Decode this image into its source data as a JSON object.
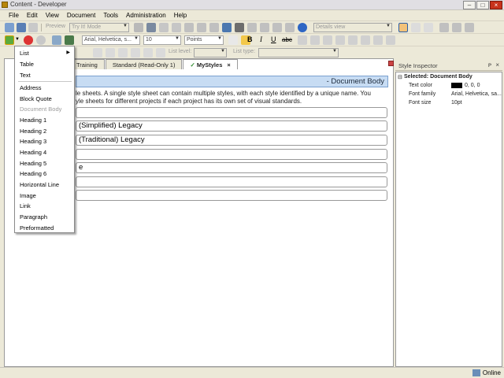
{
  "window": {
    "title": "Content - Developer",
    "min": "–",
    "max": "□",
    "close": "×"
  },
  "menubar": [
    "File",
    "Edit",
    "View",
    "Document",
    "Tools",
    "Administration",
    "Help"
  ],
  "toolbar1": {
    "preview_label": "Preview",
    "mode_select": "Try It! Mode",
    "view_select": "Details view"
  },
  "toolbar2": {
    "font_select": "Arial, Helvetica, s...",
    "size_select": "10",
    "unit_select": "Points",
    "bold": "B",
    "italic": "I",
    "underline": "U"
  },
  "toolbar3": {
    "list_level_label": "List level:",
    "list_type_label": "List type:"
  },
  "tabs": [
    {
      "label": "Training"
    },
    {
      "label": "Standard (Read-Only 1)"
    },
    {
      "label": "MyStyles",
      "close": "×"
    }
  ],
  "document": {
    "header": "- Document Body",
    "intro_line1": "le sheets. A single style sheet can contain multiple styles, with each style identified by a unique name. You",
    "intro_line2": "yle sheets for different projects if each project has its own set of visual standards.",
    "rows": [
      "",
      "(Simplified) Legacy",
      "(Traditional) Legacy",
      "",
      "e",
      "",
      ""
    ]
  },
  "dropdown": {
    "items": [
      {
        "label": "List",
        "submenu": true,
        "disabled": false
      },
      {
        "label": "Table",
        "disabled": false
      },
      {
        "label": "Text",
        "disabled": false
      },
      {
        "label": "Address",
        "disabled": false
      },
      {
        "label": "Block Quote",
        "disabled": false
      },
      {
        "label": "Document Body",
        "disabled": true
      },
      {
        "label": "Heading 1",
        "disabled": false
      },
      {
        "label": "Heading 2",
        "disabled": false
      },
      {
        "label": "Heading 3",
        "disabled": false
      },
      {
        "label": "Heading 4",
        "disabled": false
      },
      {
        "label": "Heading 5",
        "disabled": false
      },
      {
        "label": "Heading 6",
        "disabled": false
      },
      {
        "label": "Horizontal Line",
        "disabled": false
      },
      {
        "label": "Image",
        "disabled": false
      },
      {
        "label": "Link",
        "disabled": false
      },
      {
        "label": "Paragraph",
        "disabled": false
      },
      {
        "label": "Preformatted",
        "disabled": false
      }
    ],
    "submenu_arrow": "▶"
  },
  "inspector": {
    "title": "Style Inspector",
    "selected": "Selected: Document Body",
    "expand_glyph": "⊟",
    "pin_glyph": "ᴘ",
    "close_glyph": "×",
    "props": [
      {
        "label": "Text color",
        "value": "0, 0, 0",
        "swatch": "#000000"
      },
      {
        "label": "Font family",
        "value": "Arial, Helvetica, sa..."
      },
      {
        "label": "Font size",
        "value": "10pt"
      }
    ]
  },
  "status": {
    "online": "Online"
  },
  "colors": {
    "header_bg": "#c7dcf3",
    "close_button": "#c8331c",
    "window_bg": "#ece9d8"
  }
}
